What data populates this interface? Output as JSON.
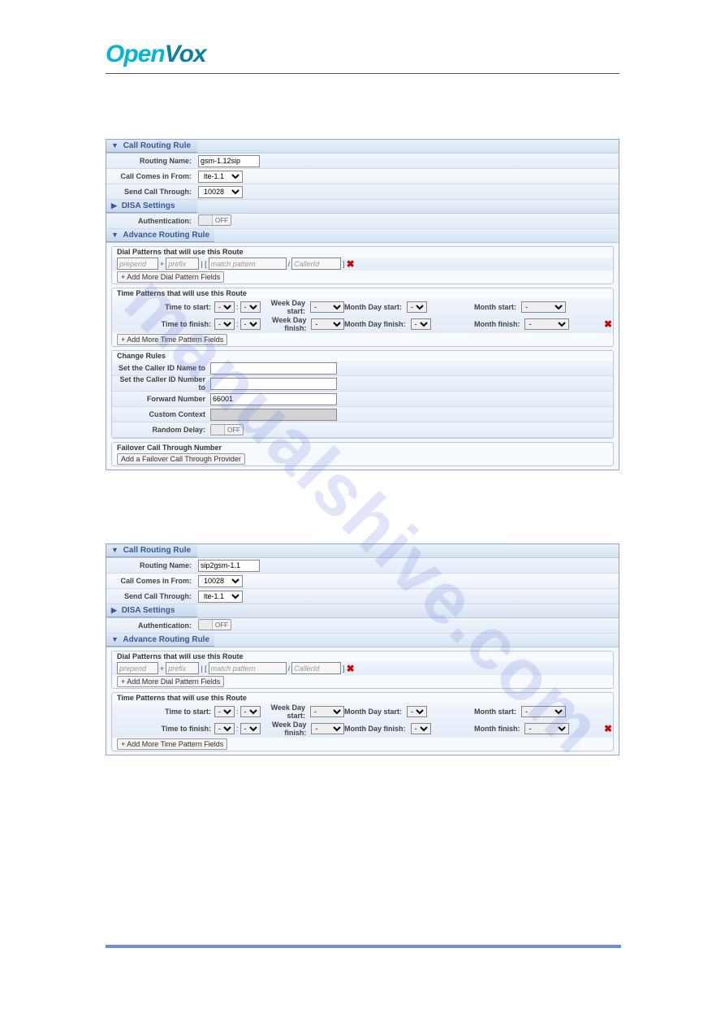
{
  "watermark": "manualshive.com",
  "logo": {
    "open": "Open",
    "vox": "Vox"
  },
  "shared": {
    "call_routing_rule": "Call Routing Rule",
    "disa_settings": "DISA Settings",
    "advance_routing_rule": "Advance Routing Rule",
    "routing_name_label": "Routing Name:",
    "call_comes_in_from_label": "Call Comes in From:",
    "send_call_through_label": "Send Call Through:",
    "authentication_label": "Authentication:",
    "off": "OFF",
    "dial_patterns_title": "Dial Patterns that will use this Route",
    "prepend": "prepend",
    "prefix": "prefix",
    "match_pattern": "match pattern",
    "callerid": "CallerId",
    "plus": "+",
    "pipe": "| [",
    "sq_close": "/",
    "bracket_close": "]",
    "add_dial": "+ Add More Dial Pattern Fields",
    "time_patterns_title": "Time Patterns that will use this Route",
    "time_to_start": "Time to start:",
    "time_to_finish": "Time to finish:",
    "week_day_start": "Week Day start:",
    "week_day_finish": "Week Day finish:",
    "month_day_start": "Month Day start:",
    "month_day_finish": "Month Day finish:",
    "month_start": "Month start:",
    "month_finish": "Month finish:",
    "dash": "-",
    "colon": ":",
    "add_time": "+ Add More Time Pattern Fields",
    "change_rules": "Change Rules",
    "set_caller_id_name": "Set the Caller ID Name to",
    "set_caller_id_number": "Set the Caller ID Number to",
    "forward_number": "Forward Number",
    "custom_context": "Custom Context",
    "random_delay": "Random Delay:",
    "failover_title": "Failover Call Through Number",
    "add_failover": "Add a Failover Call Through Provider"
  },
  "panel1": {
    "routing_name": "gsm-1.12sip",
    "call_comes_in_from": "lte-1.1",
    "send_call_through": "10028",
    "forward_number": "66001"
  },
  "panel2": {
    "routing_name": "sip2gsm-1.1",
    "call_comes_in_from": "10028",
    "send_call_through": "lte-1.1"
  }
}
